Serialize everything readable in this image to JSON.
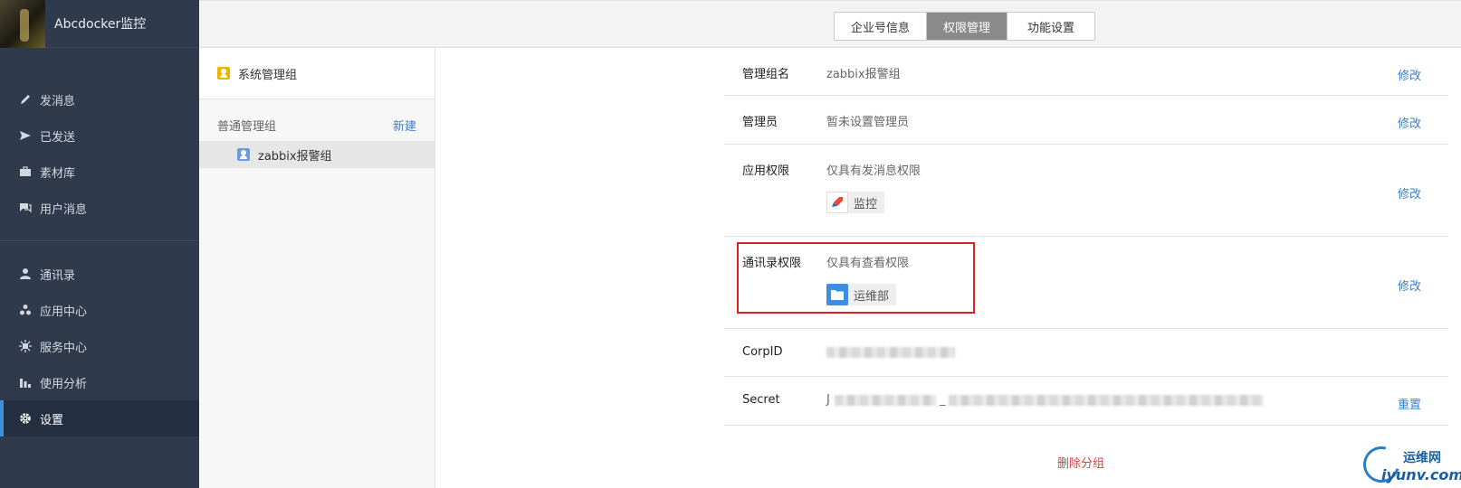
{
  "app": {
    "name": "Abcdocker监控"
  },
  "sidebar": {
    "group1": [
      {
        "label": "发消息",
        "icon": "pencil-icon"
      },
      {
        "label": "已发送",
        "icon": "send-icon"
      },
      {
        "label": "素材库",
        "icon": "briefcase-icon"
      },
      {
        "label": "用户消息",
        "icon": "chat-icon"
      }
    ],
    "group2": [
      {
        "label": "通讯录",
        "icon": "person-icon"
      },
      {
        "label": "应用中心",
        "icon": "apps-icon"
      },
      {
        "label": "服务中心",
        "icon": "service-icon"
      },
      {
        "label": "使用分析",
        "icon": "bar-chart-icon"
      },
      {
        "label": "设置",
        "icon": "gear-icon",
        "active": true
      }
    ]
  },
  "tabs": [
    {
      "label": "企业号信息"
    },
    {
      "label": "权限管理",
      "active": true
    },
    {
      "label": "功能设置"
    }
  ],
  "groups": {
    "system_group": "系统管理组",
    "normal_header": "普通管理组",
    "new_label": "新建",
    "items": [
      {
        "label": "zabbix报警组"
      }
    ]
  },
  "details": {
    "name_label": "管理组名",
    "name_value": "zabbix报警组",
    "admin_label": "管理员",
    "admin_value": "暂未设置管理员",
    "app_perm_label": "应用权限",
    "app_perm_value": "仅具有发消息权限",
    "app_chip": "监控",
    "contacts_perm_label": "通讯录权限",
    "contacts_perm_value": "仅具有查看权限",
    "contacts_chip": "运维部",
    "corpid_label": "CorpID",
    "secret_label": "Secret",
    "secret_prefix": "J",
    "secret_sep": "_",
    "edit_label": "修改",
    "reset_label": "重置",
    "delete_label": "删除分组"
  },
  "watermark": {
    "line1": "运维网",
    "line2": "iyunv.com"
  },
  "colors": {
    "sidebar_bg": "#2f3a4d",
    "accent": "#3d7fc9",
    "highlight": "#e02020",
    "danger": "#e0403c"
  }
}
